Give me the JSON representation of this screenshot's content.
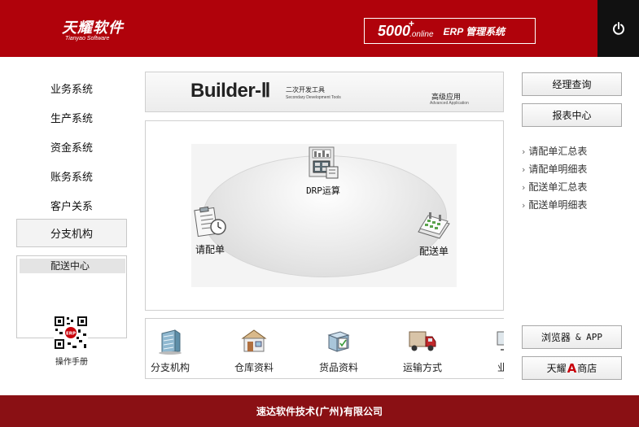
{
  "header": {
    "logo_cn": "天耀软件",
    "logo_en": "Tianyao Software",
    "brand_number": "5000",
    "brand_plus": "+",
    "brand_online": ".online",
    "brand_erp": "ERP 管理系统"
  },
  "sidebar": {
    "items": [
      "业务系统",
      "生产系统",
      "资金系统",
      "账务系统",
      "客户关系",
      "分支机构"
    ],
    "dist_center_title": "配送中心",
    "manual_label": "操作手册",
    "qr_badge": "ERP"
  },
  "banner": {
    "builder": "Builder-",
    "roman": "Ⅱ",
    "tool_cn": "二次开发工具",
    "tool_en": "Secondary Development Tools",
    "advanced_cn": "高级应用",
    "advanced_en": "Advanced Application"
  },
  "flow": {
    "drp": "DRP运算",
    "request": "请配单",
    "delivery": "配送单"
  },
  "quick": {
    "items": [
      "分支机构",
      "仓库资料",
      "货品资料",
      "运输方式",
      "业务"
    ]
  },
  "right": {
    "manager_query": "经理查询",
    "report_center": "报表中心",
    "links": [
      "请配单汇总表",
      "请配单明细表",
      "配送单汇总表",
      "配送单明细表"
    ],
    "link_arrow": "›",
    "browser_label": "浏览器",
    "browser_app": "& APP",
    "store_left": "天耀",
    "store_a": "A",
    "store_right": "商店"
  },
  "footer": {
    "company": "速达软件技术(广州)有限公司"
  },
  "colors": {
    "header_red": "#b0020b",
    "footer_red": "#8a1014",
    "power_bg": "#111111"
  }
}
